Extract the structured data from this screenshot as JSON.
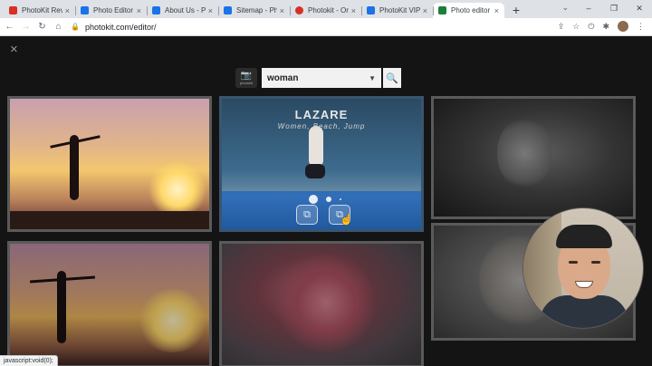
{
  "browser": {
    "tabs": [
      {
        "title": "PhotoKit Revie",
        "favicon_color": "#d93025",
        "active": false
      },
      {
        "title": "Photo Editor |",
        "favicon_color": "#1a73e8",
        "active": false
      },
      {
        "title": "About Us - Pho",
        "favicon_color": "#1a73e8",
        "active": false
      },
      {
        "title": "Sitemap - Phot",
        "favicon_color": "#1a73e8",
        "active": false
      },
      {
        "title": "Photokit - Onli",
        "favicon_color": "#d93025",
        "active": false
      },
      {
        "title": "PhotoKit VIP (",
        "favicon_color": "#1a73e8",
        "active": false
      },
      {
        "title": "Photo editor -",
        "favicon_color": "#188038",
        "active": true
      }
    ],
    "new_tab": "+",
    "tab_close": "×",
    "url": "photokit.com/editor/",
    "window_controls": {
      "minimize": "–",
      "restore": "❐",
      "close": "✕"
    },
    "nav": {
      "back": "←",
      "forward": "→",
      "reload": "↻",
      "home": "⌂"
    },
    "status_text": "javascript:void(0);"
  },
  "editor": {
    "close": "×",
    "logo_label": "photokit",
    "search": {
      "value": "woman",
      "dropdown": "▼",
      "search_icon": "⚲"
    },
    "hover_card": {
      "title": "LAZARE",
      "tags": "Women, Beach, Jump"
    }
  },
  "colors": {
    "hover_bar": "#1e64be",
    "page_bg": "#141414"
  }
}
